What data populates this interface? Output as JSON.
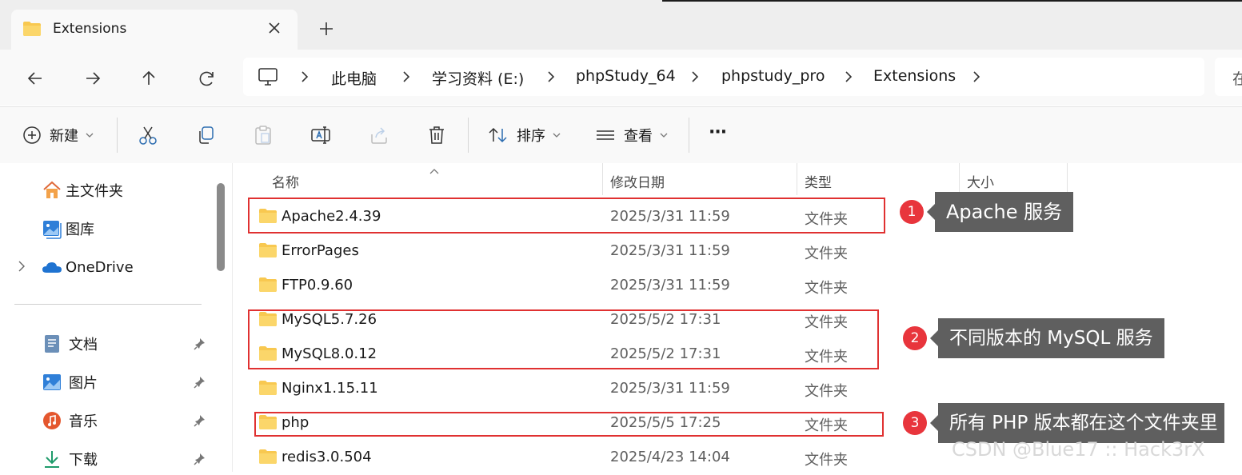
{
  "tab": {
    "title": "Extensions"
  },
  "address": {
    "crumbs": [
      "此电脑",
      "学习资料 (E:)",
      "phpStudy_64",
      "phpstudy_pro",
      "Extensions"
    ],
    "search_partial": "在"
  },
  "toolbar": {
    "new_label": "新建",
    "sort_label": "排序",
    "view_label": "查看",
    "more_label": "···"
  },
  "nav": {
    "home": "主文件夹",
    "gallery": "图库",
    "onedrive": "OneDrive",
    "documents": "文档",
    "pictures": "图片",
    "music": "音乐",
    "downloads": "下载"
  },
  "columns": {
    "name": "名称",
    "modified": "修改日期",
    "type": "类型",
    "size": "大小"
  },
  "files": [
    {
      "name": "Apache2.4.39",
      "date": "2025/3/31 11:59",
      "type": "文件夹"
    },
    {
      "name": "ErrorPages",
      "date": "2025/3/31 11:59",
      "type": "文件夹"
    },
    {
      "name": "FTP0.9.60",
      "date": "2025/3/31 11:59",
      "type": "文件夹"
    },
    {
      "name": "MySQL5.7.26",
      "date": "2025/5/2 17:31",
      "type": "文件夹"
    },
    {
      "name": "MySQL8.0.12",
      "date": "2025/5/2 17:31",
      "type": "文件夹"
    },
    {
      "name": "Nginx1.15.11",
      "date": "2025/3/31 11:59",
      "type": "文件夹"
    },
    {
      "name": "php",
      "date": "2025/5/5 17:25",
      "type": "文件夹"
    },
    {
      "name": "redis3.0.504",
      "date": "2025/4/23 14:04",
      "type": "文件夹"
    }
  ],
  "annotations": [
    {
      "number": "1",
      "text": "Apache 服务"
    },
    {
      "number": "2",
      "text": "不同版本的 MySQL 服务"
    },
    {
      "number": "3",
      "text": "所有 PHP 版本都在这个文件夹里"
    }
  ],
  "watermark": "CSDN @Blue17 :: Hack3rX",
  "colors": {
    "highlight": "#e03131",
    "badge": "#e8353c",
    "callout": "#5f5f5f",
    "folder": "#f8c850"
  }
}
